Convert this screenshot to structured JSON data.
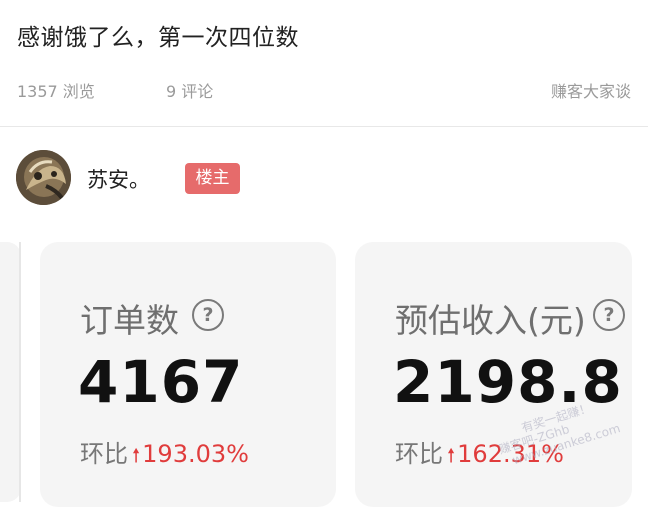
{
  "post": {
    "title": "感谢饿了么，第一次四位数",
    "views": "1357 浏览",
    "comments": "9 评论",
    "forum": "赚客大家谈"
  },
  "author": {
    "name": "苏安。",
    "badge": "楼主",
    "avatar_icon": "avatar-photo"
  },
  "stats": [
    {
      "label": "订单数",
      "value": "4167",
      "compare_label": "环比",
      "trend": "up",
      "change": "193.03%"
    },
    {
      "label": "预估收入(元)",
      "value": "2198.8",
      "compare_label": "环比",
      "trend": "up",
      "change": "162.31%"
    }
  ],
  "watermark": {
    "line1": "有奖一起赚！",
    "line2": "赚客吧-ZGhb",
    "line3": "www.zuanke8.com"
  },
  "colors": {
    "badge_bg": "#e66b6b",
    "trend_up": "#e03c3c",
    "card_bg": "#f5f5f5"
  }
}
